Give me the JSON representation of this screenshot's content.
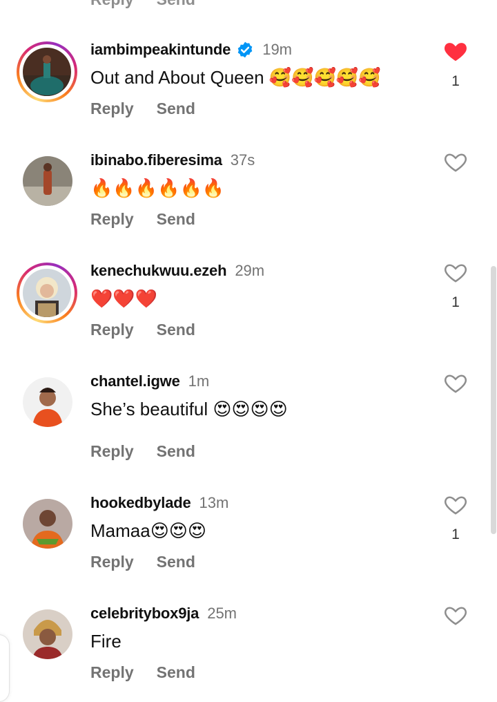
{
  "colors": {
    "like_red": "#ff3040",
    "verified_blue": "#0095f6",
    "muted": "#737373"
  },
  "top_partial": {
    "reply": "Reply",
    "send": "Send"
  },
  "comments": [
    {
      "username": "iambimpeakintunde",
      "verified": true,
      "time": "19m",
      "text": "Out and About Queen 🥰🥰🥰🥰🥰",
      "reply": "Reply",
      "send": "Send",
      "liked": true,
      "like_count": "1",
      "has_story_ring": true
    },
    {
      "username": "ibinabo.fiberesima",
      "time": "37s",
      "text": "🔥🔥🔥🔥🔥🔥",
      "reply": "Reply",
      "send": "Send",
      "liked": false,
      "has_story_ring": false
    },
    {
      "username": "kenechukwuu.ezeh",
      "time": "29m",
      "text": "❤️❤️❤️",
      "reply": "Reply",
      "send": "Send",
      "liked": false,
      "like_count": "1",
      "has_story_ring": true
    },
    {
      "username": "chantel.igwe",
      "time": "1m",
      "text": "She’s beautiful 😍😍😍😍",
      "reply": "Reply",
      "send": "Send",
      "liked": false,
      "has_story_ring": false
    },
    {
      "username": "hookedbylade",
      "time": "13m",
      "text": "Mamaa😍😍😍",
      "reply": "Reply",
      "send": "Send",
      "liked": false,
      "like_count": "1",
      "has_story_ring": false
    },
    {
      "username": "celebritybox9ja",
      "time": "25m",
      "text": "Fire",
      "reply": "Reply",
      "send": "Send",
      "liked": false,
      "has_story_ring": false
    }
  ]
}
